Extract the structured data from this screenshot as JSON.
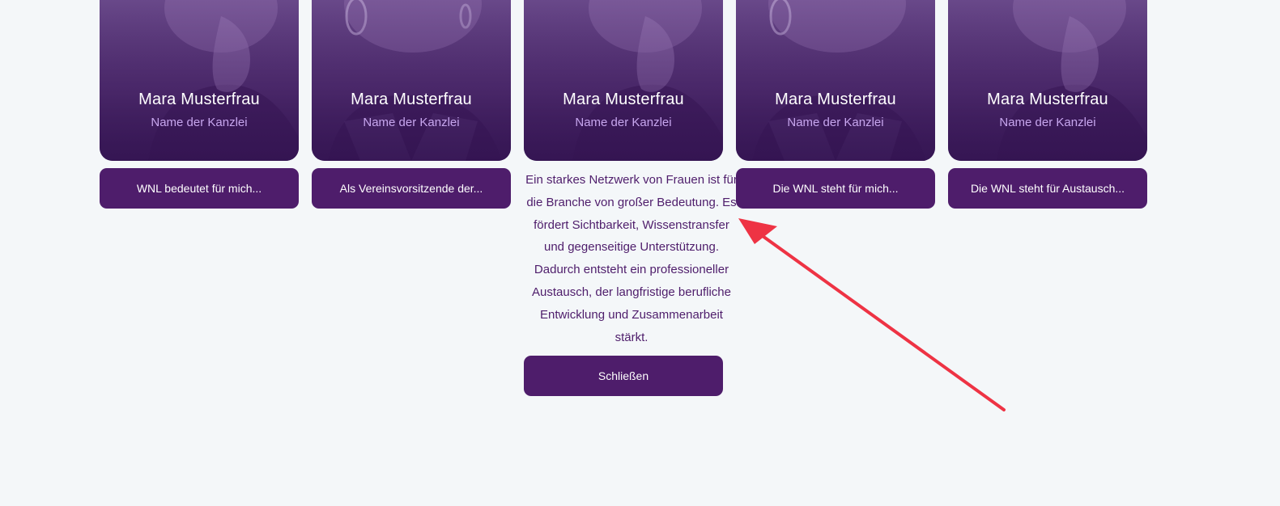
{
  "profiles": [
    {
      "name": "Mara Musterfrau",
      "firm": "Name der Kanzlei",
      "button_label": "WNL bedeutet für mich..."
    },
    {
      "name": "Mara Musterfrau",
      "firm": "Name der Kanzlei",
      "button_label": "Als Vereinsvorsitzende der..."
    },
    {
      "name": "Mara Musterfrau",
      "firm": "Name der Kanzlei",
      "quote": "Ein starkes Netzwerk von Frauen ist für die Branche von großer Bedeutung. Es fördert Sichtbarkeit, Wissenstransfer und gegenseitige Unterstützung. Dadurch entsteht ein professioneller Austausch, der langfristige berufliche Entwicklung und Zusammenarbeit stärkt.",
      "close_label": "Schließen"
    },
    {
      "name": "Mara Musterfrau",
      "firm": "Name der Kanzlei",
      "button_label": "Die WNL steht für mich..."
    },
    {
      "name": "Mara Musterfrau",
      "firm": "Name der Kanzlei",
      "button_label": "Die WNL steht für Austausch..."
    }
  ],
  "icons": {
    "annotation_arrow": "arrow-icon"
  },
  "colors": {
    "background": "#f4f7f9",
    "brand_purple": "#4e1d6b",
    "firm_lavender": "#c7a6ee",
    "annotation_red": "#ee3344"
  }
}
